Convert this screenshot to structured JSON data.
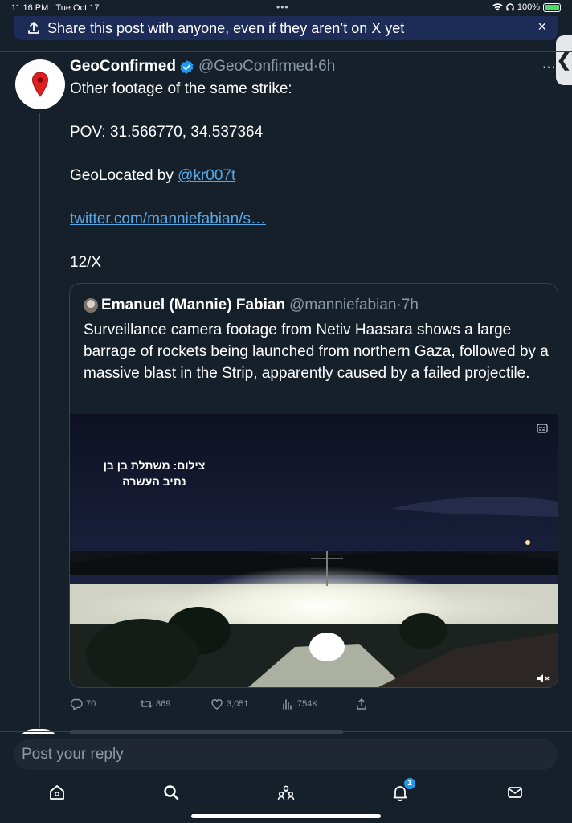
{
  "status_bar": {
    "time": "11:16 PM",
    "date": "Tue Oct 17",
    "battery": "100%"
  },
  "share_banner": {
    "text": "Share this post with anyone, even if they aren’t on X yet",
    "close": "×"
  },
  "side_handle": "❮",
  "tweet": {
    "author_name": "GeoConfirmed",
    "handle": "@GeoConfirmed",
    "separator": "·",
    "time": "6h",
    "more": "···",
    "line1": "Other footage of the same strike:",
    "line2": "POV: 31.566770, 34.537364",
    "line3_prefix": "GeoLocated by ",
    "line3_mention": "@kr007t",
    "link": "twitter.com/manniefabian/s…",
    "line5": "12/X"
  },
  "quote": {
    "name": "Emanuel (Mannie) Fabian",
    "handle": "@manniefabian",
    "separator": "·",
    "time": "7h",
    "text": "Surveillance camera footage from Netiv Haasara shows a large barrage of rockets being launched from northern Gaza, followed by a massive blast in the Strip, apparently caused by a failed projectile.",
    "video_caption_line1": "צילום: משתלת בן בן",
    "video_caption_line2": "נתיב העשרה"
  },
  "actions": {
    "replies": "70",
    "reposts": "869",
    "likes": "3,051",
    "views": "754K"
  },
  "reply": {
    "placeholder": "Post your reply"
  },
  "tabbar": {
    "notification_count": "1"
  },
  "colors": {
    "background": "#15202b",
    "accent": "#1d9bf0",
    "link": "#5aa9e6",
    "banner": "#1d2b57"
  }
}
